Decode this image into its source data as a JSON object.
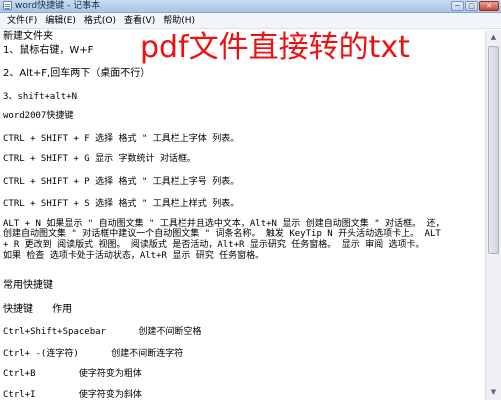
{
  "window": {
    "title": "word快捷键 - 记事本",
    "controls": {
      "minimize": "─",
      "maximize": "□",
      "close": "✕"
    }
  },
  "menu": [
    "文件(F)",
    "编辑(E)",
    "格式(O)",
    "查看(V)",
    "帮助(H)"
  ],
  "overlay_title": "pdf文件直接转的txt",
  "content_lines": [
    "新建文件夹",
    "1、鼠标右键，W+F",
    "2、Alt+F,回车两下（桌面不行）",
    "3、shift+alt+N",
    "word2007快捷键",
    "CTRL + SHIFT + F 选择 格式 \" 工具栏上字体 列表。",
    "CTRL + SHIFT + G 显示 字数统计 对话框。",
    "CTRL + SHIFT + P 选择 格式 \" 工具栏上字号 列表。",
    "CTRL + SHIFT + S 选择 格式 \" 工具栏上样式 列表。",
    "ALT + N 如果显示 \" 自动图文集 \" 工具栏并且选中文本，Alt+N 显示 创建自动图文集 \" 对话框。 还，",
    "创建自动图文集 \" 对话框中建议一个自动图文集 \" 词条名称。 触发 KeyTip N 开头活动选项卡上。 ALT",
    "+ R 更改到 阅读版式 视图。 阅读版式 是否活动，Alt+R 显示研究 任务窗格。 显示 审阅 选项卡。",
    "如果 检查 选项卡处于活动状态，Alt+R 显示 研究 任务窗格。",
    "常用快捷键",
    "快捷键      作用",
    "Ctrl+Shift+Spacebar      创建不间断空格",
    "Ctrl+ -(连字符)      创建不间断连字符",
    "Ctrl+B        使字符变为粗体",
    "Ctrl+I        使字符变为斜体"
  ]
}
